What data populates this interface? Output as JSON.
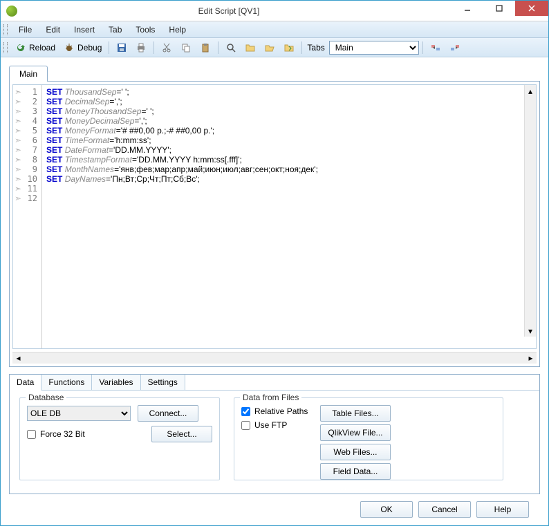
{
  "window": {
    "title": "Edit Script  [QV1]"
  },
  "menu": {
    "file": "File",
    "edit": "Edit",
    "insert": "Insert",
    "tab": "Tab",
    "tools": "Tools",
    "help": "Help"
  },
  "toolbar": {
    "reload": "Reload",
    "debug": "Debug",
    "tabs_label": "Tabs",
    "tabs_value": "Main"
  },
  "editor": {
    "tab": "Main",
    "lines": [
      {
        "n": "1",
        "kw": "SET",
        "var": "ThousandSep",
        "rest": "=' ';"
      },
      {
        "n": "2",
        "kw": "SET",
        "var": "DecimalSep",
        "rest": "=',';"
      },
      {
        "n": "3",
        "kw": "SET",
        "var": "MoneyThousandSep",
        "rest": "=' ';"
      },
      {
        "n": "4",
        "kw": "SET",
        "var": "MoneyDecimalSep",
        "rest": "=',';"
      },
      {
        "n": "5",
        "kw": "SET",
        "var": "MoneyFormat",
        "rest": "='# ##0,00 р.;-# ##0,00 р.';"
      },
      {
        "n": "6",
        "kw": "SET",
        "var": "TimeFormat",
        "rest": "='h:mm:ss';"
      },
      {
        "n": "7",
        "kw": "SET",
        "var": "DateFormat",
        "rest": "='DD.MM.YYYY';"
      },
      {
        "n": "8",
        "kw": "SET",
        "var": "TimestampFormat",
        "rest": "='DD.MM.YYYY h:mm:ss[.fff]';"
      },
      {
        "n": "9",
        "kw": "SET",
        "var": "MonthNames",
        "rest": "='янв;фев;мар;апр;май;июн;июл;авг;сен;окт;ноя;дек';"
      },
      {
        "n": "10",
        "kw": "SET",
        "var": "DayNames",
        "rest": "='Пн;Вт;Ср;Чт;Пт;Сб;Вс';"
      },
      {
        "n": "11",
        "kw": "",
        "var": "",
        "rest": ""
      },
      {
        "n": "12",
        "kw": "",
        "var": "",
        "rest": ""
      }
    ]
  },
  "bottom": {
    "tabs": {
      "data": "Data",
      "functions": "Functions",
      "variables": "Variables",
      "settings": "Settings"
    },
    "database": {
      "legend": "Database",
      "driver": "OLE DB",
      "connect": "Connect...",
      "select": "Select...",
      "force32": "Force 32 Bit"
    },
    "files": {
      "legend": "Data from Files",
      "relative": "Relative Paths",
      "useftp": "Use FTP",
      "tablefiles": "Table Files...",
      "qlikview": "QlikView File...",
      "webfiles": "Web Files...",
      "fielddata": "Field Data..."
    }
  },
  "actions": {
    "ok": "OK",
    "cancel": "Cancel",
    "help": "Help"
  }
}
